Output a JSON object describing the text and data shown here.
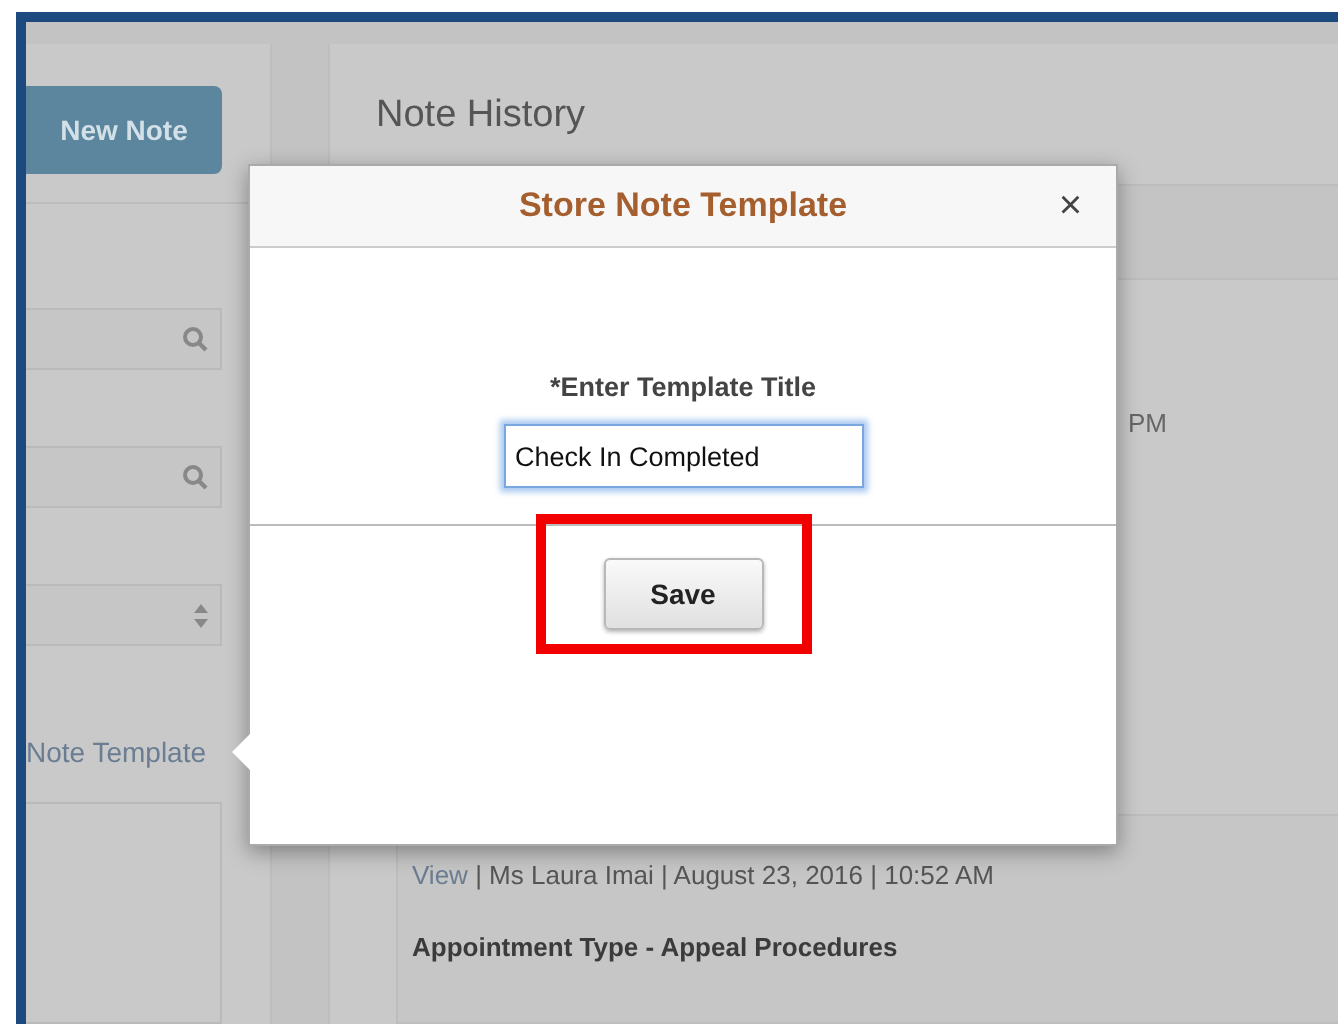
{
  "sidebar": {
    "new_note_button": "New Note",
    "search_fields": [
      {
        "kind": "search"
      },
      {
        "kind": "search"
      },
      {
        "kind": "select"
      }
    ],
    "template_link": "Note Template"
  },
  "note_history": {
    "title": "Note History",
    "partial_time": "PM",
    "notes": [
      {
        "link": "View",
        "meta": "| Ms Laura Imai | August 23, 2016 | 10:52 AM",
        "type": "Appointment Type - Appeal Procedures"
      }
    ]
  },
  "modal": {
    "title": "Store Note Template",
    "close": "×",
    "field_label": "*Enter Template Title",
    "field_value": "Check In Completed",
    "field_focused": true,
    "save_button": "Save",
    "save_highlighted": true
  }
}
